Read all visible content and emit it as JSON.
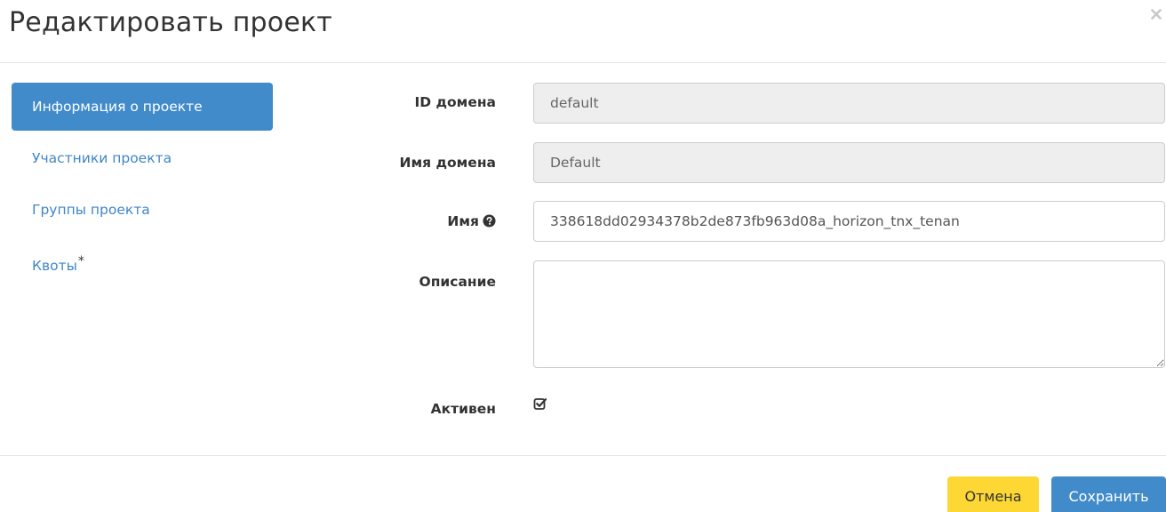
{
  "modal": {
    "title": "Редактировать проект"
  },
  "nav": {
    "items": [
      {
        "label": "Информация о проекте",
        "active": true
      },
      {
        "label": "Участники проекта",
        "active": false
      },
      {
        "label": "Группы проекта",
        "active": false
      },
      {
        "label": "Квоты",
        "active": false,
        "required_mark": "*"
      }
    ]
  },
  "form": {
    "domain_id": {
      "label": "ID домена",
      "value": "default"
    },
    "domain_name": {
      "label": "Имя домена",
      "value": "Default"
    },
    "name": {
      "label": "Имя",
      "value": "338618dd02934378b2de873fb963d08a_horizon_tnx_tenan",
      "help_icon": "question-circle-icon"
    },
    "description": {
      "label": "Описание",
      "value": ""
    },
    "enabled": {
      "label": "Активен",
      "checked": true
    }
  },
  "footer": {
    "cancel_label": "Отмена",
    "save_label": "Сохранить"
  },
  "colors": {
    "primary": "#428bca",
    "cancel": "#fdd835",
    "link": "#3f86c8"
  }
}
